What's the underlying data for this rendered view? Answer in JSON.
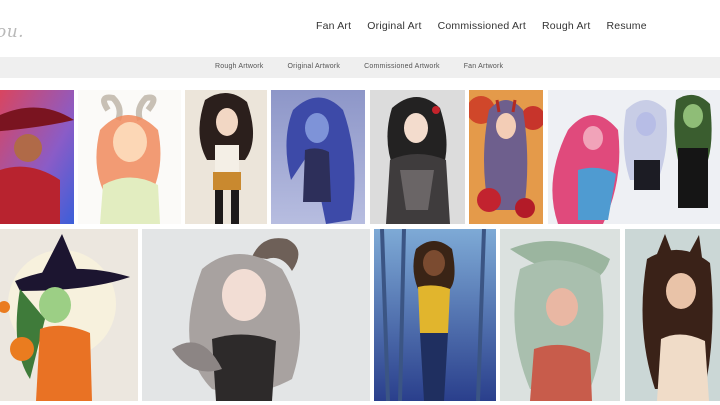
{
  "site": {
    "logo_text": "ou."
  },
  "main_nav": {
    "items": [
      {
        "label": "Fan Art"
      },
      {
        "label": "Original Art"
      },
      {
        "label": "Commissioned Art"
      },
      {
        "label": "Rough Art"
      },
      {
        "label": "Resume"
      }
    ]
  },
  "sub_nav": {
    "items": [
      {
        "label": "Rough Artwork"
      },
      {
        "label": "Original Artwork"
      },
      {
        "label": "Commissioned Artwork"
      },
      {
        "label": "Fan Artwork"
      }
    ]
  },
  "colors": {
    "header_bg": "#ffffff",
    "subnav_bg": "#efefef",
    "logo": "#b9b9b9",
    "nav_text": "#333333"
  }
}
